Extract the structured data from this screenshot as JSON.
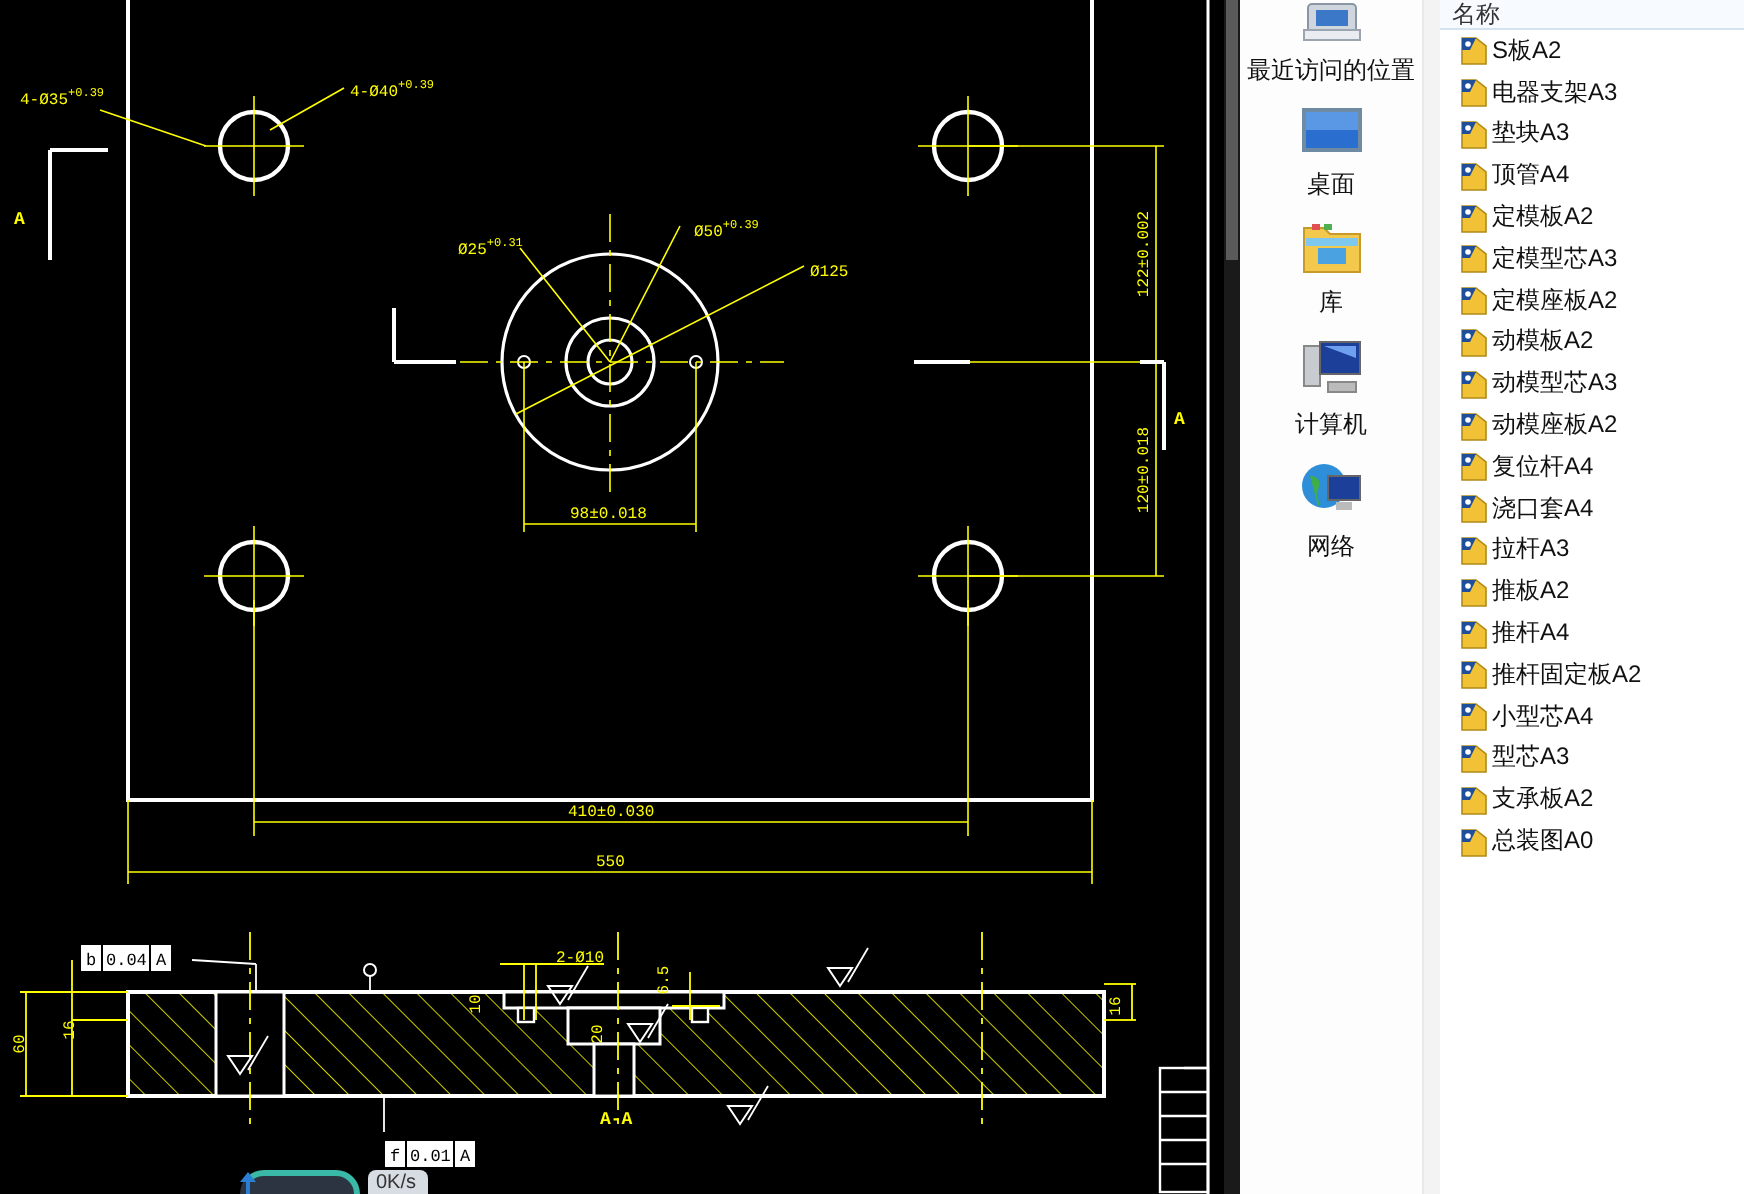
{
  "drawing": {
    "labels": [
      {
        "kind": "dimension",
        "text": "4-Ø35",
        "tolerance": "+0.39"
      },
      {
        "kind": "dimension",
        "text": "4-Ø40",
        "tolerance": "+0.39"
      },
      {
        "kind": "dimension",
        "text": "Ø25",
        "tolerance": "+0.31"
      },
      {
        "kind": "dimension",
        "text": "Ø50",
        "tolerance": "+0.39"
      },
      {
        "kind": "dimension",
        "text": "Ø125"
      },
      {
        "kind": "dimension",
        "text": "98±0.018"
      },
      {
        "kind": "dimension",
        "text": "410±0.030"
      },
      {
        "kind": "dimension",
        "text": "550"
      },
      {
        "kind": "dimension",
        "text": "122±0.002"
      },
      {
        "kind": "dimension",
        "text": "120±0.018"
      },
      {
        "kind": "dimension",
        "text": "60"
      },
      {
        "kind": "dimension",
        "text": "16"
      },
      {
        "kind": "dimension",
        "text": "2-Ø10"
      },
      {
        "kind": "dimension",
        "text": "6.5"
      },
      {
        "kind": "dimension",
        "text": "10"
      },
      {
        "kind": "dimension",
        "text": "20"
      },
      {
        "kind": "dimension",
        "text": "16"
      },
      {
        "kind": "section_mark",
        "text": "A"
      },
      {
        "kind": "section_mark",
        "text": "A"
      },
      {
        "kind": "section_mark",
        "text": "A-A"
      }
    ],
    "tolerance_frames": [
      {
        "symbol": "b",
        "value": "0.04",
        "datum": "A"
      },
      {
        "symbol": "f",
        "value": "0.01",
        "datum": "A"
      }
    ]
  },
  "speed_widget": {
    "speed": "0K/s"
  },
  "places": [
    {
      "kind": "recent",
      "label": "最近访问的位置"
    },
    {
      "kind": "desktop",
      "label": "桌面"
    },
    {
      "kind": "library",
      "label": "库"
    },
    {
      "kind": "computer",
      "label": "计算机"
    },
    {
      "kind": "network",
      "label": "网络"
    }
  ],
  "file_list": {
    "column": "名称",
    "files": [
      "S板A2",
      "电器支架A3",
      "垫块A3",
      "顶管A4",
      "定模板A2",
      "定模型芯A3",
      "定模座板A2",
      "动模板A2",
      "动模型芯A3",
      "动模座板A2",
      "复位杆A4",
      "浇口套A4",
      "拉杆A3",
      "推板A2",
      "推杆A4",
      "推杆固定板A2",
      "小型芯A4",
      "型芯A3",
      "支承板A2",
      "总装图A0"
    ]
  }
}
